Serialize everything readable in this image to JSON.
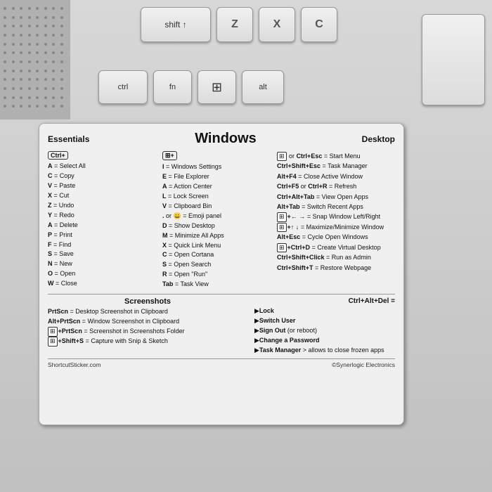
{
  "keyboard": {
    "top_label": "shift ↑",
    "keys": [
      "Z",
      "X",
      "C"
    ],
    "bottom_keys": [
      "ctrl",
      "fn",
      "⊞",
      "alt"
    ]
  },
  "sticker": {
    "title_left": "Essentials",
    "title_center": "Windows",
    "title_right": "Desktop",
    "ctrl_label": "Ctrl+",
    "win_label": "⊞+",
    "essentials": [
      "A = Select All",
      "C = Copy",
      "V = Paste",
      "X = Cut",
      "Z = Undo",
      "Y = Redo",
      "A = Delete",
      "P = Print",
      "F = Find",
      "S = Save",
      "N = New",
      "O = Open",
      "W = Close"
    ],
    "win_shortcuts": [
      "I = Windows Settings",
      "E = File Explorer",
      "A = Action Center",
      "L = Lock Screen",
      "V = Clipboard Bin",
      ". or 😀 = Emoji panel",
      "D = Show Desktop",
      "M = Minimize All Apps",
      "X = Quick Link Menu",
      "C = Open Cortana",
      "S = Open Search",
      "R = Open \"Run\"",
      "Tab = Task View"
    ],
    "desktop": [
      "⊞ or Ctrl+Esc = Start Menu",
      "Ctrl+Shift+Esc = Task Manager",
      "Alt+F4 = Close Active Window",
      "Ctrl+F5 or Ctrl+R = Refresh",
      "Ctrl+Alt+Tab = View Open Apps",
      "Alt+Tab = Switch Recent Apps",
      "⊞+← → = Snap Window Left/Right",
      "⊞+↑ ↓ = Maximize/Minimize Window",
      "Alt+Esc = Cycle Open Windows",
      "⊞+Ctrl+D = Create Virtual Desktop",
      "Ctrl+Shift+Click = Run as Admin",
      "Ctrl+Shift+T = Restore Webpage"
    ],
    "screenshots_title": "Screenshots",
    "screenshots": [
      "PrtScn = Desktop Screenshot in Clipboard",
      "Alt+PrtScn = Window Screenshot in Clipboard",
      "⊞+PrtScn = Screenshot in Screenshots Folder",
      "⊞+Shift+S = Capture with Snip & Sketch"
    ],
    "ctrl_alt_del_title": "Ctrl+Alt+Del =",
    "ctrl_alt_del": [
      "▶Lock",
      "▶Switch User",
      "▶Sign Out (or reboot)",
      "▶Change a Password",
      "▶Task Manager > allows to close frozen apps"
    ],
    "footer_left": "ShortcutSticker.com",
    "footer_right": "©Synerlogic Electronics"
  }
}
